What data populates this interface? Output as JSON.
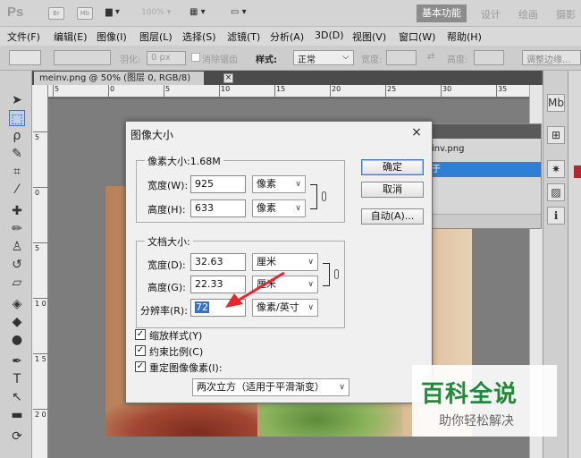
{
  "app": {
    "logo": "Ps",
    "icons": [
      "Br",
      "Mb"
    ],
    "zoom_label": "100%",
    "workspaces": {
      "active": "基本功能",
      "others": [
        "设计",
        "绘画",
        "摄影"
      ]
    }
  },
  "menu": [
    "文件(F)",
    "编辑(E)",
    "图像(I)",
    "图层(L)",
    "选择(S)",
    "滤镜(T)",
    "分析(A)",
    "3D(D)",
    "视图(V)",
    "窗口(W)",
    "帮助(H)"
  ],
  "options": {
    "feather_label": "羽化:",
    "feather_value": "0 px",
    "antialias_label": "消除锯齿",
    "style_label": "样式:",
    "style_value": "正常",
    "width_label": "宽度:",
    "height_label": "高度:",
    "refine_label": "调整边缘..."
  },
  "document": {
    "tab_title": "meinv.png @ 50% (图层 0, RGB/8)",
    "tab_close": "×"
  },
  "rulers": {
    "h_labels": [
      "5",
      "0",
      "5",
      "10",
      "15",
      "20",
      "25",
      "30",
      "35"
    ],
    "v_labels": [
      "5",
      "0",
      "5",
      "1 0",
      "1 5",
      "2 0",
      "2 5"
    ]
  },
  "layers_panel": {
    "doc_name": "inv.png",
    "selected_layer": "于"
  },
  "dialog": {
    "title": "图像大小",
    "close": "×",
    "pixel_group": {
      "legend": "像素大小:1.68M",
      "width_label": "宽度(W):",
      "width_value": "925",
      "width_unit": "像素",
      "height_label": "高度(H):",
      "height_value": "633",
      "height_unit": "像素"
    },
    "doc_group": {
      "legend": "文档大小:",
      "width_label": "宽度(D):",
      "width_value": "32.63",
      "width_unit": "厘米",
      "height_label": "高度(G):",
      "height_value": "22.33",
      "height_unit": "厘米",
      "res_label": "分辨率(R):",
      "res_value": "72",
      "res_unit": "像素/英寸"
    },
    "buttons": {
      "ok": "确定",
      "cancel": "取消",
      "auto": "自动(A)..."
    },
    "checkboxes": [
      {
        "label": "缩放样式(Y)",
        "checked": true
      },
      {
        "label": "约束比例(C)",
        "checked": true
      },
      {
        "label": "重定图像像素(I):",
        "checked": true
      }
    ],
    "resample_method": "两次立方（适用于平滑渐变）",
    "arrow_color": "#e8262b"
  },
  "watermark": {
    "main": "百科全说",
    "sub": "助你轻松解决",
    "color": "#1f8a3a"
  }
}
